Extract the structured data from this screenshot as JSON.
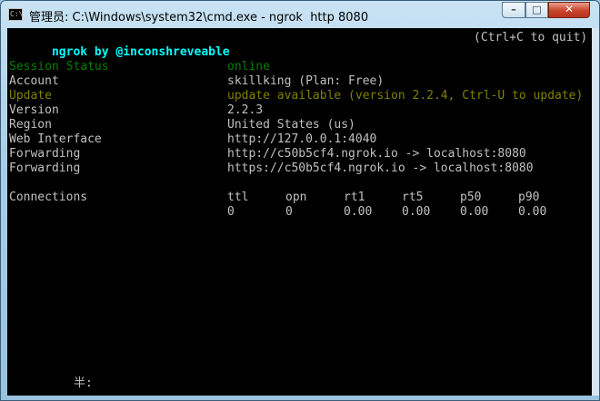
{
  "window": {
    "title": "管理员: C:\\Windows\\system32\\cmd.exe - ngrok  http 8080",
    "icon_label": "C:\\",
    "minimize_symbol": "–",
    "maximize_symbol": "□",
    "close_symbol": "✕"
  },
  "header": {
    "brand": "ngrok by @inconshreveable",
    "quit_hint": "(Ctrl+C to quit)"
  },
  "status_rows": [
    {
      "label": "Session Status",
      "value": "online"
    },
    {
      "label": "Account",
      "value": "skillking (Plan: Free)"
    },
    {
      "label": "Update",
      "value": "update available (version 2.2.4, Ctrl-U to update)"
    },
    {
      "label": "Version",
      "value": "2.2.3"
    },
    {
      "label": "Region",
      "value": "United States (us)"
    },
    {
      "label": "Web Interface",
      "value": "http://127.0.0.1:4040"
    },
    {
      "label": "Forwarding",
      "value": "http://c50b5cf4.ngrok.io -> localhost:8080"
    },
    {
      "label": "Forwarding",
      "value": "https://c50b5cf4.ngrok.io -> localhost:8080"
    }
  ],
  "connections": {
    "label": "Connections",
    "headers": [
      "ttl",
      "opn",
      "rt1",
      "rt5",
      "p50",
      "p90"
    ],
    "values": [
      "0",
      "0",
      "0.00",
      "0.00",
      "0.00",
      "0.00"
    ]
  },
  "ime_indicator": "半:",
  "colors": {
    "console_bg": "#000000",
    "text": "#c0c0c0",
    "brand": "#00ffff",
    "online": "#008000",
    "update": "#808000"
  }
}
